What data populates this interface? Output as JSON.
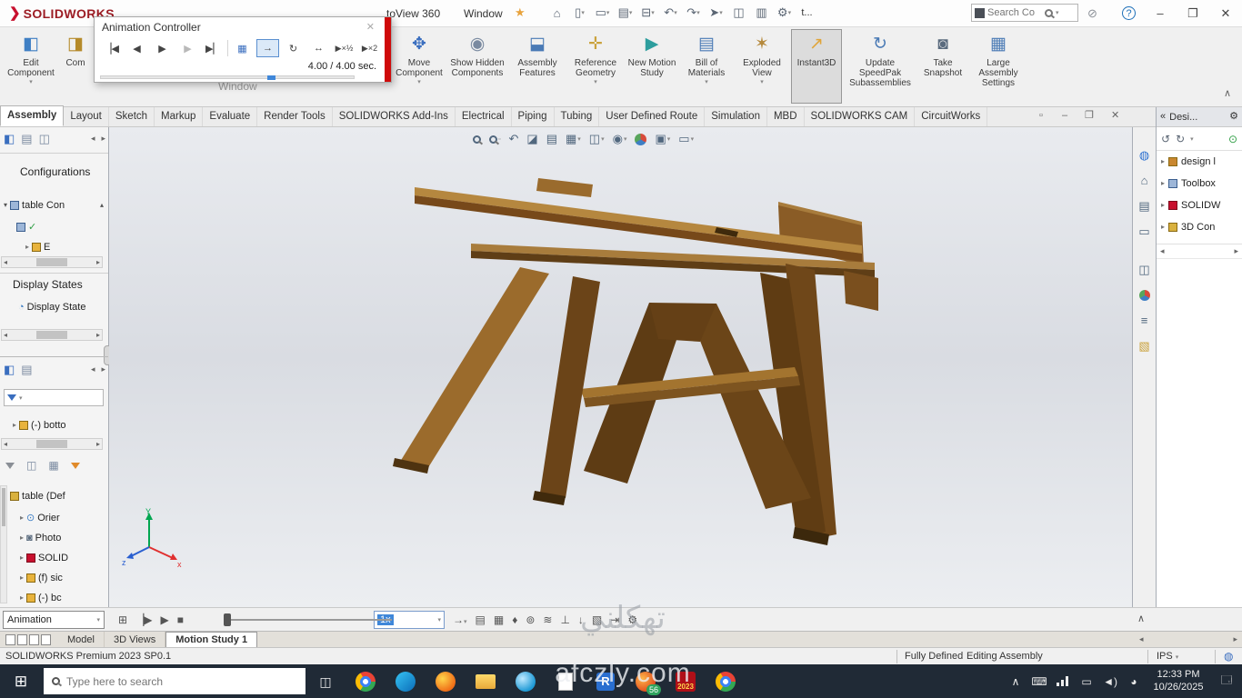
{
  "colors": {
    "solidworks_red": "#c8102e",
    "selection_blue": "#3f87d9",
    "taskbar_bg": "#202a36",
    "wood_light": "#b5873f",
    "wood_dark": "#5e3c14"
  },
  "titlebar": {
    "logo": "SOLIDWORKS",
    "menu_photoview": "toView 360",
    "menu_window": "Window",
    "quick_access_t": "t...",
    "search_placeholder": "Search Co"
  },
  "animation_controller": {
    "title": "Animation Controller",
    "time_readout": "4.00 / 4.00 sec."
  },
  "ribbon": {
    "window_ghost_label": "Window",
    "buttons": [
      {
        "label": "Edit Component"
      },
      {
        "label": "Com"
      },
      {
        "label": "Move Component"
      },
      {
        "label": "Show Hidden Components"
      },
      {
        "label": "Assembly Features"
      },
      {
        "label": "Reference Geometry"
      },
      {
        "label": "New Motion Study"
      },
      {
        "label": "Bill of Materials"
      },
      {
        "label": "Exploded View"
      },
      {
        "label": "Instant3D"
      },
      {
        "label": "Update SpeedPak Subassemblies"
      },
      {
        "label": "Take Snapshot"
      },
      {
        "label": "Large Assembly Settings"
      }
    ]
  },
  "command_tabs": [
    "Assembly",
    "Layout",
    "Sketch",
    "Markup",
    "Evaluate",
    "Render Tools",
    "SOLIDWORKS Add-Ins",
    "Electrical",
    "Piping",
    "Tubing",
    "User Defined Route",
    "Simulation",
    "MBD",
    "SOLIDWORKS CAM",
    "CircuitWorks"
  ],
  "left_panel": {
    "configurations_header": "Configurations",
    "config_root": "table Con",
    "config_sub": "E",
    "display_states_header": "Display States",
    "display_state_item": "Display State",
    "bottom_item": "(-) botto",
    "tree_root": "table (Def",
    "tree_children": [
      "Orier",
      "Photo",
      "SOLID",
      "(f) sic",
      "(-) bc"
    ],
    "animation_select": "Animation"
  },
  "motion_study": {
    "speed": "1x",
    "tabs": [
      "Model",
      "3D Views",
      "Motion Study 1"
    ]
  },
  "status_bar": {
    "product": "SOLIDWORKS Premium 2023 SP0.1",
    "state": "Fully Defined",
    "mode": "Editing Assembly",
    "units": "IPS"
  },
  "task_pane": {
    "header": "Desi...",
    "items": [
      "design l",
      "Toolbox",
      "SOLIDW",
      "3D Con"
    ]
  },
  "taskbar": {
    "search_placeholder": "Type here to search",
    "solidworks_year": "2023",
    "badge": "56",
    "time": "12:33 PM",
    "date": "10/26/2025"
  },
  "watermark": {
    "line1": "تهكلني",
    "line2": "afczly.com"
  }
}
